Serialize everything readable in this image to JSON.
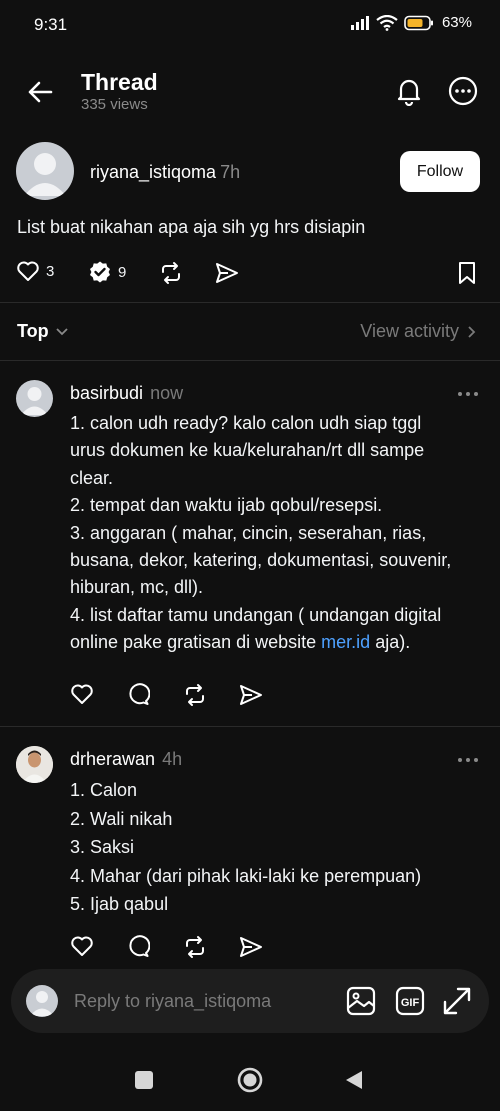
{
  "status": {
    "time": "9:31",
    "battery": "63%"
  },
  "header": {
    "title": "Thread",
    "views": "335 views"
  },
  "post": {
    "username": "riyana_istiqoma",
    "time": "7h",
    "follow_label": "Follow",
    "text": "List buat nikahan apa aja sih yg hrs disiapin",
    "likes": "3",
    "reposts": "9"
  },
  "sort": {
    "label": "Top",
    "view_activity": "View activity"
  },
  "replies": [
    {
      "username": "basirbudi",
      "time": "now",
      "lines": [
        "1. calon udh ready? kalo calon udh siap tggl",
        "urus dokumen ke kua/kelurahan/rt dll sampe",
        "clear.",
        "2. tempat dan waktu ijab qobul/resepsi.",
        "3. anggaran ( mahar, cincin, seserahan, rias,",
        "busana, dekor, katering, dokumentasi, souvenir,",
        "hiburan, mc, dll).",
        "4. list daftar tamu undangan ( undangan digital"
      ],
      "last_line_prefix": "online pake gratisan di website ",
      "link_text": "mer.id",
      "last_line_suffix": " aja)."
    },
    {
      "username": "drherawan",
      "time": "4h",
      "lines": [
        "1. Calon",
        "2. Wali nikah",
        "3. Saksi",
        "4. Mahar (dari pihak laki-laki ke perempuan)",
        "5. Ijab qabul"
      ]
    }
  ],
  "composer": {
    "placeholder": "Reply to riyana_istiqoma"
  },
  "colors": {
    "background": "#101010",
    "link": "#4ea1ff",
    "muted": "#7a7a7a"
  }
}
